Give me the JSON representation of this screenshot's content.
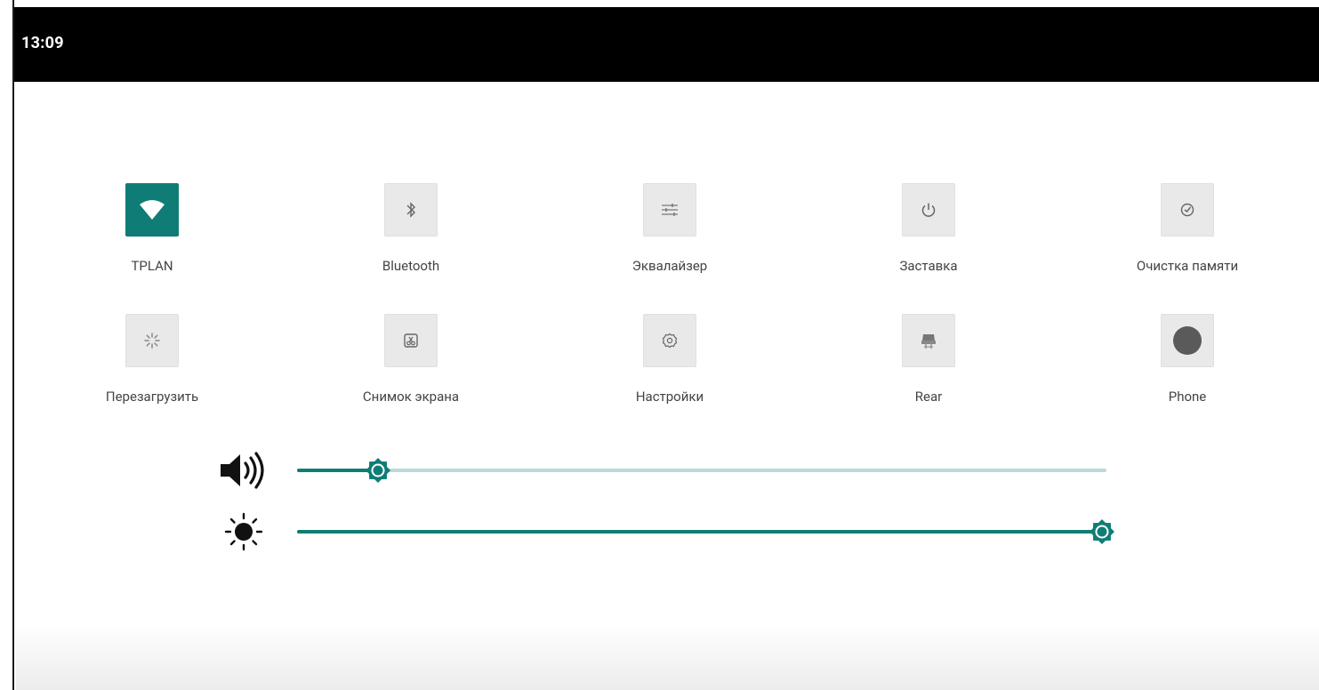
{
  "status_bar": {
    "time": "13:09"
  },
  "tiles": [
    {
      "label": "TPLAN",
      "icon": "wifi-icon",
      "active": true
    },
    {
      "label": "Bluetooth",
      "icon": "bluetooth-icon",
      "active": false
    },
    {
      "label": "Эквалайзер",
      "icon": "equalizer-icon",
      "active": false
    },
    {
      "label": "Заставка",
      "icon": "power-icon",
      "active": false
    },
    {
      "label": "Очистка памяти",
      "icon": "memory-clean-icon",
      "active": false
    },
    {
      "label": "Перезагрузить",
      "icon": "restart-icon",
      "active": false
    },
    {
      "label": "Снимок экрана",
      "icon": "screenshot-icon",
      "active": false
    },
    {
      "label": "Настройки",
      "icon": "settings-icon",
      "active": false
    },
    {
      "label": "Rear",
      "icon": "rear-camera-icon",
      "active": false
    },
    {
      "label": "Phone",
      "icon": "phone-icon",
      "active": false
    }
  ],
  "sliders": {
    "volume": {
      "icon": "volume-icon",
      "level": 0.1
    },
    "brightness": {
      "icon": "brightness-icon",
      "level": 1.0
    }
  },
  "colors": {
    "accent": "#0f7d75",
    "track_inactive": "#b9dbd7",
    "status_bar_bg": "#000000",
    "tile_inactive_bg": "#e9e9e9"
  }
}
